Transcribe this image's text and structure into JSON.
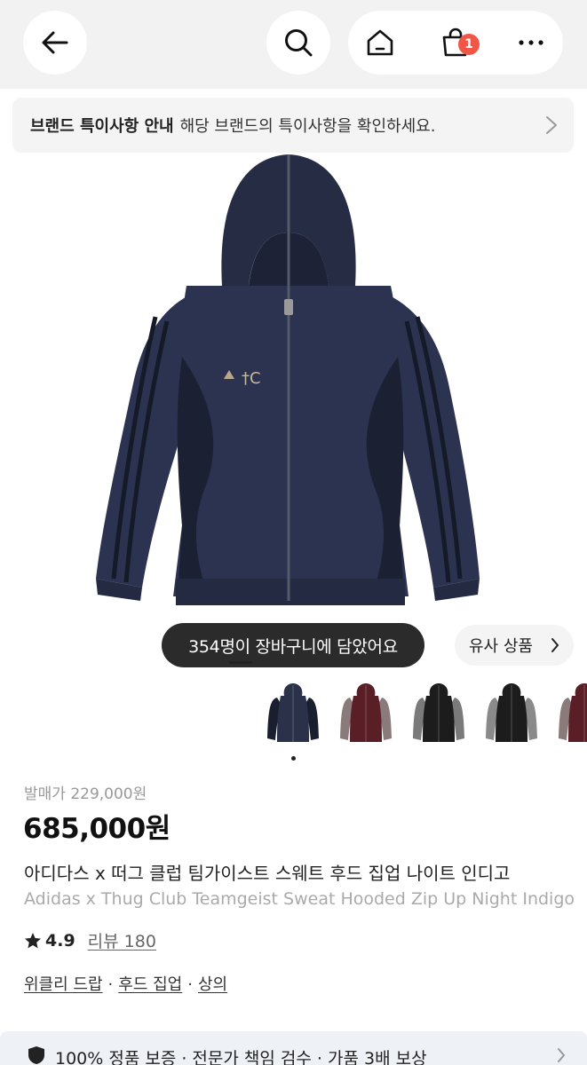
{
  "header": {
    "cart_count": "1",
    "icons": [
      "back-arrow-icon",
      "search-icon",
      "home-icon",
      "shopping-bag-icon",
      "more-icon"
    ]
  },
  "notice": {
    "title": "브랜드 특이사항 안내",
    "description": "해당 브랜드의 특이사항을 확인하세요."
  },
  "hero": {
    "cart_message": "354명이 장바구니에 담았어요",
    "similar_label": "유사 상품"
  },
  "thumbnails": [
    {
      "color": "#2a3148",
      "accent": "#1a1f30"
    },
    {
      "color": "#5a1e26",
      "accent": "#8a7a7a"
    },
    {
      "color": "#1c1c1c",
      "accent": "#7a7a7a"
    },
    {
      "color": "#1c1c1c",
      "accent": "#8a8a8a"
    },
    {
      "color": "#5a1e26",
      "accent": "#8a7a7a"
    }
  ],
  "product": {
    "release_price": "발매가 229,000원",
    "price": "685,000원",
    "name_ko": "아디다스 x 떠그 클럽 팀가이스트 스웨트 후드 집업 나이트 인디고",
    "name_en": "Adidas x Thug Club Teamgeist Sweat Hooded Zip Up Night Indigo",
    "rating": "4.9",
    "review_label": "리뷰 180",
    "categories": [
      "위클리 드랍",
      "후드 집업",
      "상의"
    ]
  },
  "guarantee": {
    "text": "100% 정품 보증 · 전문가 책임 검수 · 가품 3배 보상"
  },
  "colors": {
    "badge": "#f15746",
    "jacket": "#2c3350",
    "jacket_dark": "#1b2033",
    "cart_pill_bg": "#2b2b2b"
  }
}
